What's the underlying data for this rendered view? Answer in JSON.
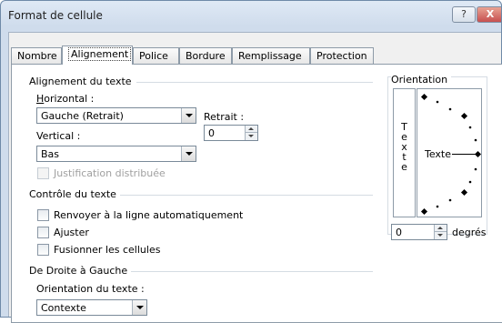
{
  "window": {
    "title": "Format de cellule",
    "help_glyph": "?",
    "close_glyph": "X"
  },
  "tabs": [
    "Nombre",
    "Alignement",
    "Police",
    "Bordure",
    "Remplissage",
    "Protection"
  ],
  "alignment": {
    "group": "Alignement du texte",
    "horizontal_label": "Horizontal :",
    "horizontal_value": "Gauche (Retrait)",
    "retrait_label": "Retrait :",
    "retrait_value": "0",
    "vertical_label": "Vertical :",
    "vertical_value": "Bas",
    "justification_label": "Justification distribuée"
  },
  "text_control": {
    "group": "Contrôle du texte",
    "wrap_label": "Renvoyer à la ligne automatiquement",
    "shrink_label": "Ajuster",
    "merge_label": "Fusionner les cellules"
  },
  "rtl": {
    "group": "De Droite à Gauche",
    "direction_label": "Orientation du texte :",
    "direction_value": "Contexte"
  },
  "orientation": {
    "group": "Orientation",
    "vertical_letters": [
      "T",
      "e",
      "x",
      "t",
      "e"
    ],
    "dial_text": "Texte",
    "degrees_value": "0",
    "degrees_label": "degrés"
  }
}
